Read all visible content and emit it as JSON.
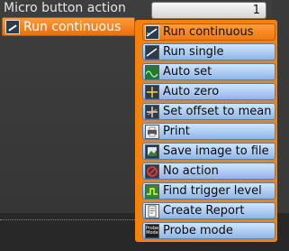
{
  "panel": {
    "title": "Micro button action",
    "value": "1",
    "selected_label": "Run continuous"
  },
  "menu": {
    "items": [
      {
        "label": "Run continuous",
        "icon": "run-continuous-icon",
        "selected": true
      },
      {
        "label": "Run single",
        "icon": "run-single-icon"
      },
      {
        "label": "Auto set",
        "icon": "auto-set-icon"
      },
      {
        "label": "Auto zero",
        "icon": "auto-zero-icon"
      },
      {
        "label": "Set offset to mean",
        "icon": "offset-mean-icon"
      },
      {
        "label": "Print",
        "icon": "printer-icon"
      },
      {
        "label": "Save image to file",
        "icon": "save-image-icon"
      },
      {
        "label": "No action",
        "icon": "no-action-icon"
      },
      {
        "label": "Find trigger level",
        "icon": "trigger-level-icon"
      },
      {
        "label": "Create Report",
        "icon": "report-icon"
      },
      {
        "label": "Probe mode",
        "icon": "probe-mode-icon",
        "icon_text": "Probe Mode"
      }
    ]
  },
  "colors": {
    "accent_orange": "#f4820a",
    "menu_item_blue": "#a9cbf2",
    "background": "#3b3b3b"
  }
}
